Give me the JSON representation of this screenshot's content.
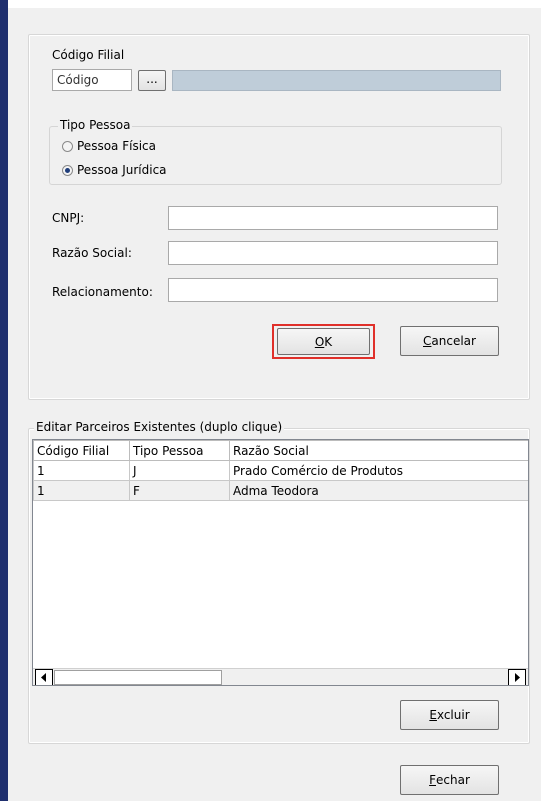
{
  "filial": {
    "label": "Código Filial",
    "code_placeholder": "Código",
    "lookup_label": "...",
    "name_value": ""
  },
  "tipo_pessoa": {
    "legend": "Tipo Pessoa",
    "options": [
      {
        "label": "Pessoa Física",
        "checked": false
      },
      {
        "label": "Pessoa Jurídica",
        "checked": true
      }
    ]
  },
  "fields": {
    "cnpj_label": "CNPJ:",
    "cnpj_value": "",
    "razao_label": "Razão Social:",
    "razao_value": "",
    "relacionamento_label": "Relacionamento:",
    "relacionamento_value": ""
  },
  "actions": {
    "ok": {
      "mnemonic": "O",
      "rest": "K"
    },
    "cancelar": {
      "mnemonic": "C",
      "rest": "ancelar"
    },
    "highlight_color": "#e0302a"
  },
  "parceiros": {
    "legend": "Editar Parceiros Existentes (duplo clique)",
    "columns": [
      "Código Filial",
      "Tipo Pessoa",
      "Razão Social"
    ],
    "rows": [
      [
        "1",
        "J",
        "Prado Comércio de Produtos"
      ],
      [
        "1",
        "F",
        "Adma Teodora"
      ]
    ],
    "excluir": {
      "mnemonic": "E",
      "rest": "xcluir"
    }
  },
  "footer": {
    "fechar": {
      "mnemonic": "F",
      "rest": "echar"
    }
  }
}
